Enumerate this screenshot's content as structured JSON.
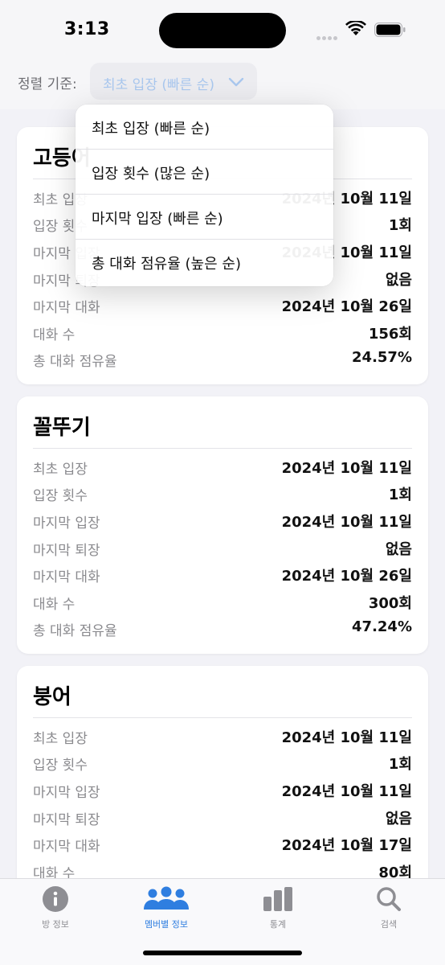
{
  "status_bar": {
    "time": "3:13"
  },
  "sort": {
    "label": "정렬 기준:",
    "selected": "최초 입장 (빠른 순)",
    "options": [
      "최초 입장 (빠른 순)",
      "입장 횟수 (많은 순)",
      "마지막 입장 (빠른 순)",
      "총 대화 점유율 (높은 순)"
    ]
  },
  "members": [
    {
      "name": "고등어",
      "rows": [
        {
          "label": "최초 입장",
          "value": "2024년 10월 11일"
        },
        {
          "label": "입장 횟수",
          "value": "1회"
        },
        {
          "label": "마지막 입장",
          "value": "2024년 10월 11일"
        },
        {
          "label": "마지막 퇴장",
          "value": "없음"
        },
        {
          "label": "마지막 대화",
          "value": "2024년 10월 26일"
        },
        {
          "label": "대화 수",
          "value": "156회"
        },
        {
          "label": "총 대화 점유율",
          "value": "24.57%"
        }
      ]
    },
    {
      "name": "꼴뚜기",
      "rows": [
        {
          "label": "최초 입장",
          "value": "2024년 10월 11일"
        },
        {
          "label": "입장 횟수",
          "value": "1회"
        },
        {
          "label": "마지막 입장",
          "value": "2024년 10월 11일"
        },
        {
          "label": "마지막 퇴장",
          "value": "없음"
        },
        {
          "label": "마지막 대화",
          "value": "2024년 10월 26일"
        },
        {
          "label": "대화 수",
          "value": "300회"
        },
        {
          "label": "총 대화 점유율",
          "value": "47.24%"
        }
      ]
    },
    {
      "name": "붕어",
      "rows": [
        {
          "label": "최초 입장",
          "value": "2024년 10월 11일"
        },
        {
          "label": "입장 횟수",
          "value": "1회"
        },
        {
          "label": "마지막 입장",
          "value": "2024년 10월 11일"
        },
        {
          "label": "마지막 퇴장",
          "value": "없음"
        },
        {
          "label": "마지막 대화",
          "value": "2024년 10월 17일"
        },
        {
          "label": "대화 수",
          "value": "80회"
        }
      ]
    }
  ],
  "tabs": [
    {
      "label": "방 정보",
      "icon": "info-circle-icon"
    },
    {
      "label": "멤버별 정보",
      "icon": "people-icon",
      "active": true
    },
    {
      "label": "통계",
      "icon": "bar-chart-icon"
    },
    {
      "label": "검색",
      "icon": "magnifier-icon"
    }
  ],
  "colors": {
    "accent": "#2f7ee0",
    "label_gray": "#8a8a8e",
    "background": "#f2f2f7"
  }
}
